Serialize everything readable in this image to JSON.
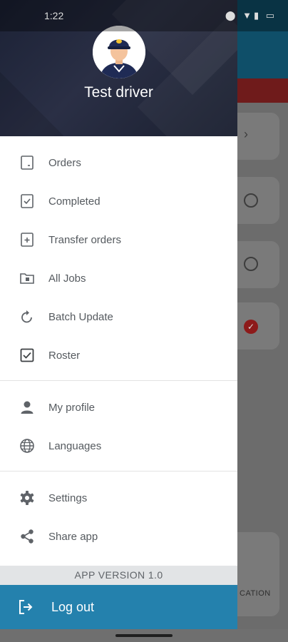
{
  "status_bar": {
    "time": "1:22",
    "right_icons": "⬤ ▼▮ ▭"
  },
  "drawer": {
    "user_name": "Test driver",
    "menu_groups": [
      [
        {
          "label": "Orders",
          "icon": "orders-icon"
        },
        {
          "label": "Completed",
          "icon": "completed-icon"
        },
        {
          "label": "Transfer orders",
          "icon": "transfer-orders-icon"
        },
        {
          "label": "All Jobs",
          "icon": "all-jobs-icon"
        },
        {
          "label": "Batch Update",
          "icon": "batch-update-icon"
        },
        {
          "label": "Roster",
          "icon": "roster-icon"
        }
      ],
      [
        {
          "label": "My profile",
          "icon": "person-icon"
        },
        {
          "label": "Languages",
          "icon": "globe-icon"
        }
      ],
      [
        {
          "label": "Settings",
          "icon": "gear-icon"
        },
        {
          "label": "Share app",
          "icon": "share-icon"
        }
      ]
    ],
    "app_version": "APP VERSION 1.0",
    "logout_label": "Log out"
  },
  "background": {
    "footer_text": "CATION",
    "chevron": "›",
    "check": "✓"
  },
  "colors": {
    "header_dark": "#1c2236",
    "logout_blue": "#2481ad",
    "icon_gray": "#5f6368"
  }
}
